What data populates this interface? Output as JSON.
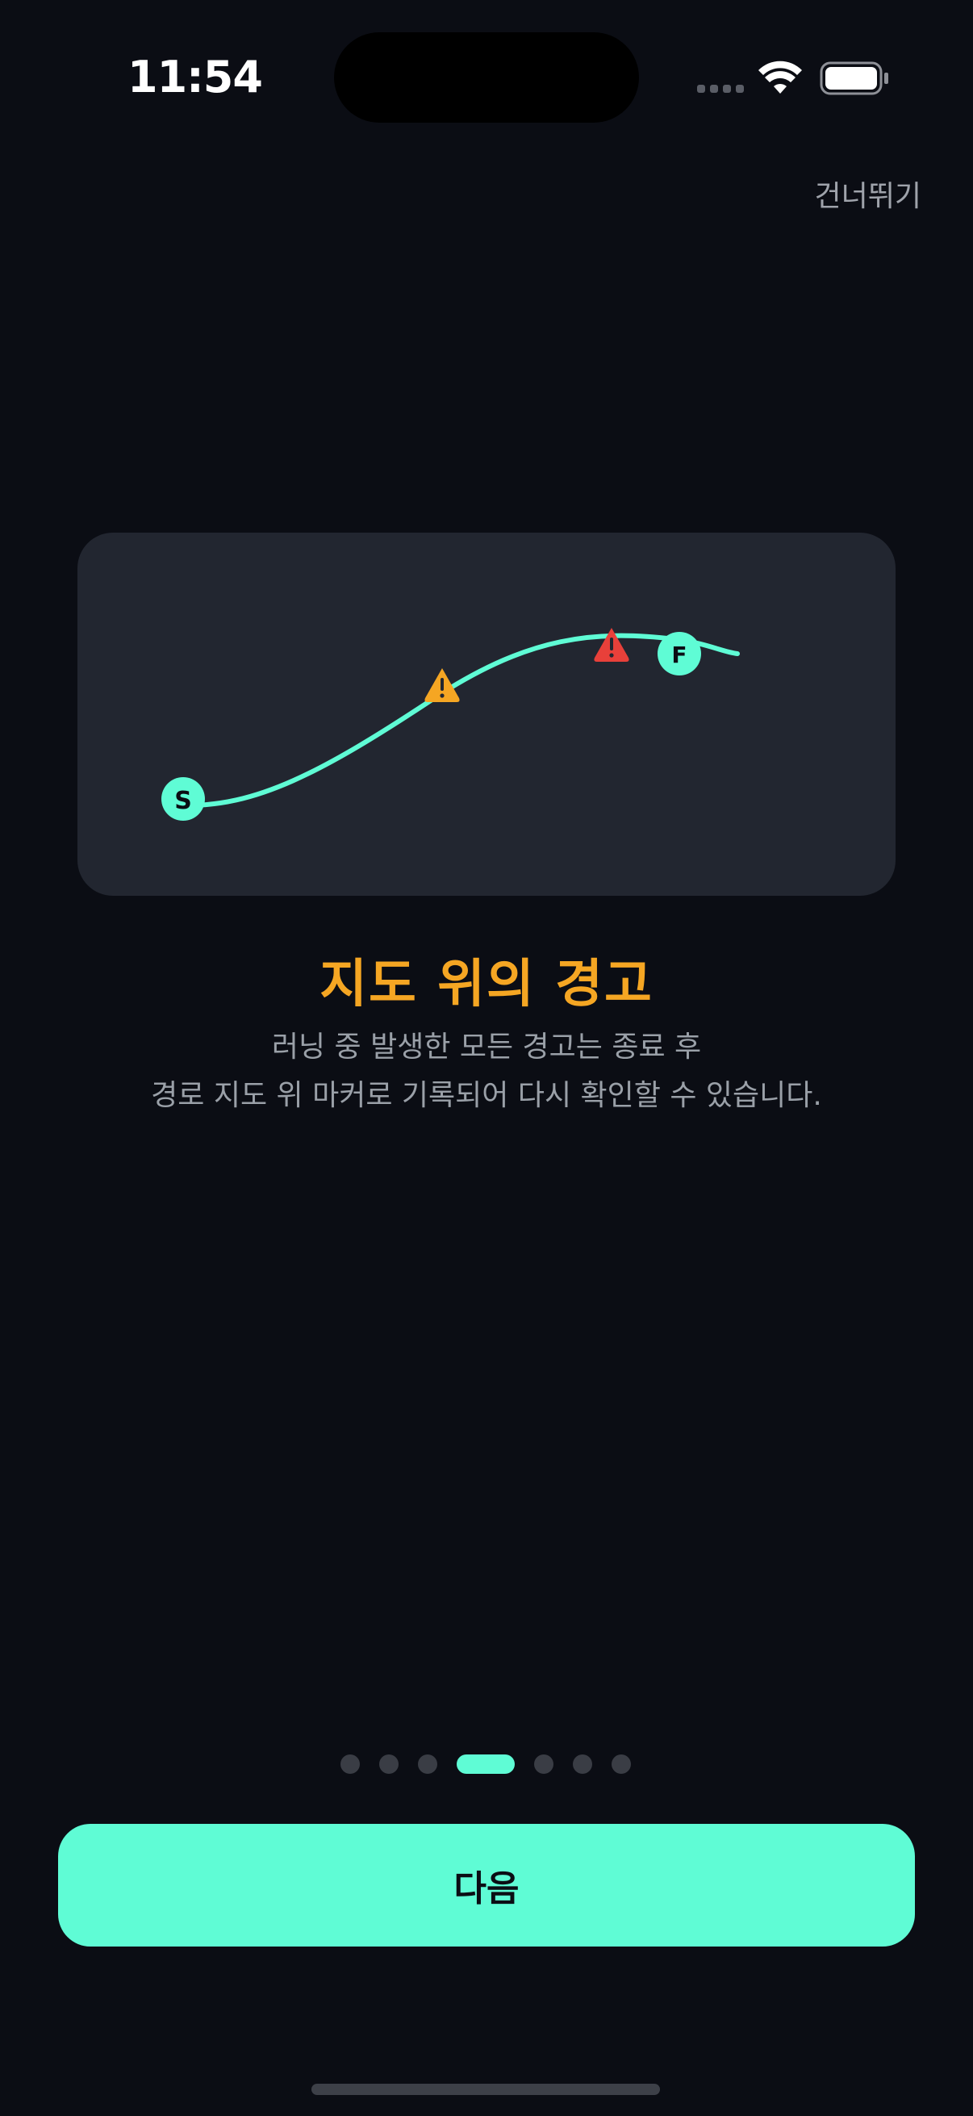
{
  "status_bar": {
    "time": "11:54",
    "wifi_icon": "wifi-icon",
    "battery_icon": "battery-icon"
  },
  "header": {
    "skip_label": "건너뛰기"
  },
  "map_card": {
    "start_label": "S",
    "finish_label": "F",
    "route_color": "#5ffcd5",
    "warning_color": "#f5a623",
    "danger_color": "#e8403a",
    "markers": [
      "warning-marker",
      "danger-marker"
    ]
  },
  "content": {
    "title": "지도 위의 경고",
    "description_line1": "러닝 중 발생한 모든 경고는 종료 후",
    "description_line2": "경로 지도 위 마커로 기록되어 다시 확인할 수 있습니다."
  },
  "pagination": {
    "total_pages": 7,
    "current_page": 4
  },
  "footer": {
    "next_label": "다음"
  },
  "colors": {
    "background": "#0b0d14",
    "card": "#222630",
    "accent": "#5ffcd5",
    "title": "#f5a623"
  }
}
